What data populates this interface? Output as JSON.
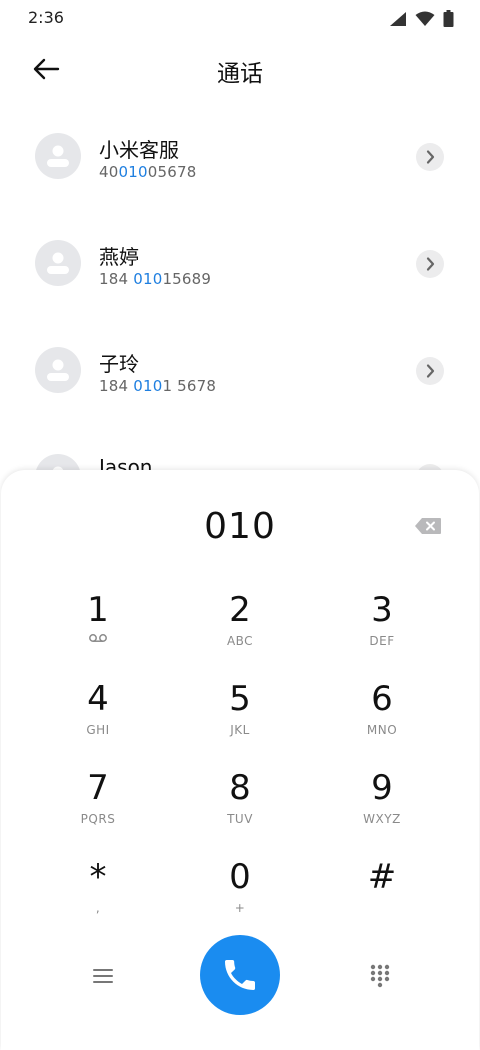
{
  "status_bar": {
    "time": "2:36",
    "icons": [
      "signal-icon",
      "wifi-icon",
      "battery-icon"
    ]
  },
  "app_bar": {
    "title": "通话",
    "back_icon": "arrow-left-icon"
  },
  "contacts": [
    {
      "name": "小米客服",
      "number_parts": [
        "40",
        "010",
        "05678"
      ]
    },
    {
      "name": "燕婷",
      "number_parts": [
        "184 ",
        "010",
        "15689"
      ]
    },
    {
      "name": "子玲",
      "number_parts": [
        "184 ",
        "010",
        "1 5678"
      ]
    },
    {
      "name": "Jason",
      "number_parts": [
        "",
        "",
        ""
      ]
    }
  ],
  "dialpad": {
    "input_value": "010",
    "keys": [
      {
        "digit": "1",
        "letters": ""
      },
      {
        "digit": "2",
        "letters": "ABC"
      },
      {
        "digit": "3",
        "letters": "DEF"
      },
      {
        "digit": "4",
        "letters": "GHI"
      },
      {
        "digit": "5",
        "letters": "JKL"
      },
      {
        "digit": "6",
        "letters": "MNO"
      },
      {
        "digit": "7",
        "letters": "PQRS"
      },
      {
        "digit": "8",
        "letters": "TUV"
      },
      {
        "digit": "9",
        "letters": "WXYZ"
      },
      {
        "digit": "*",
        "letters": ","
      },
      {
        "digit": "0",
        "letters": "+"
      },
      {
        "digit": "#",
        "letters": ""
      }
    ]
  },
  "colors": {
    "accent": "#1a8cf0",
    "highlight": "#1f7fe0",
    "avatar_bg": "#e6e7ea"
  }
}
